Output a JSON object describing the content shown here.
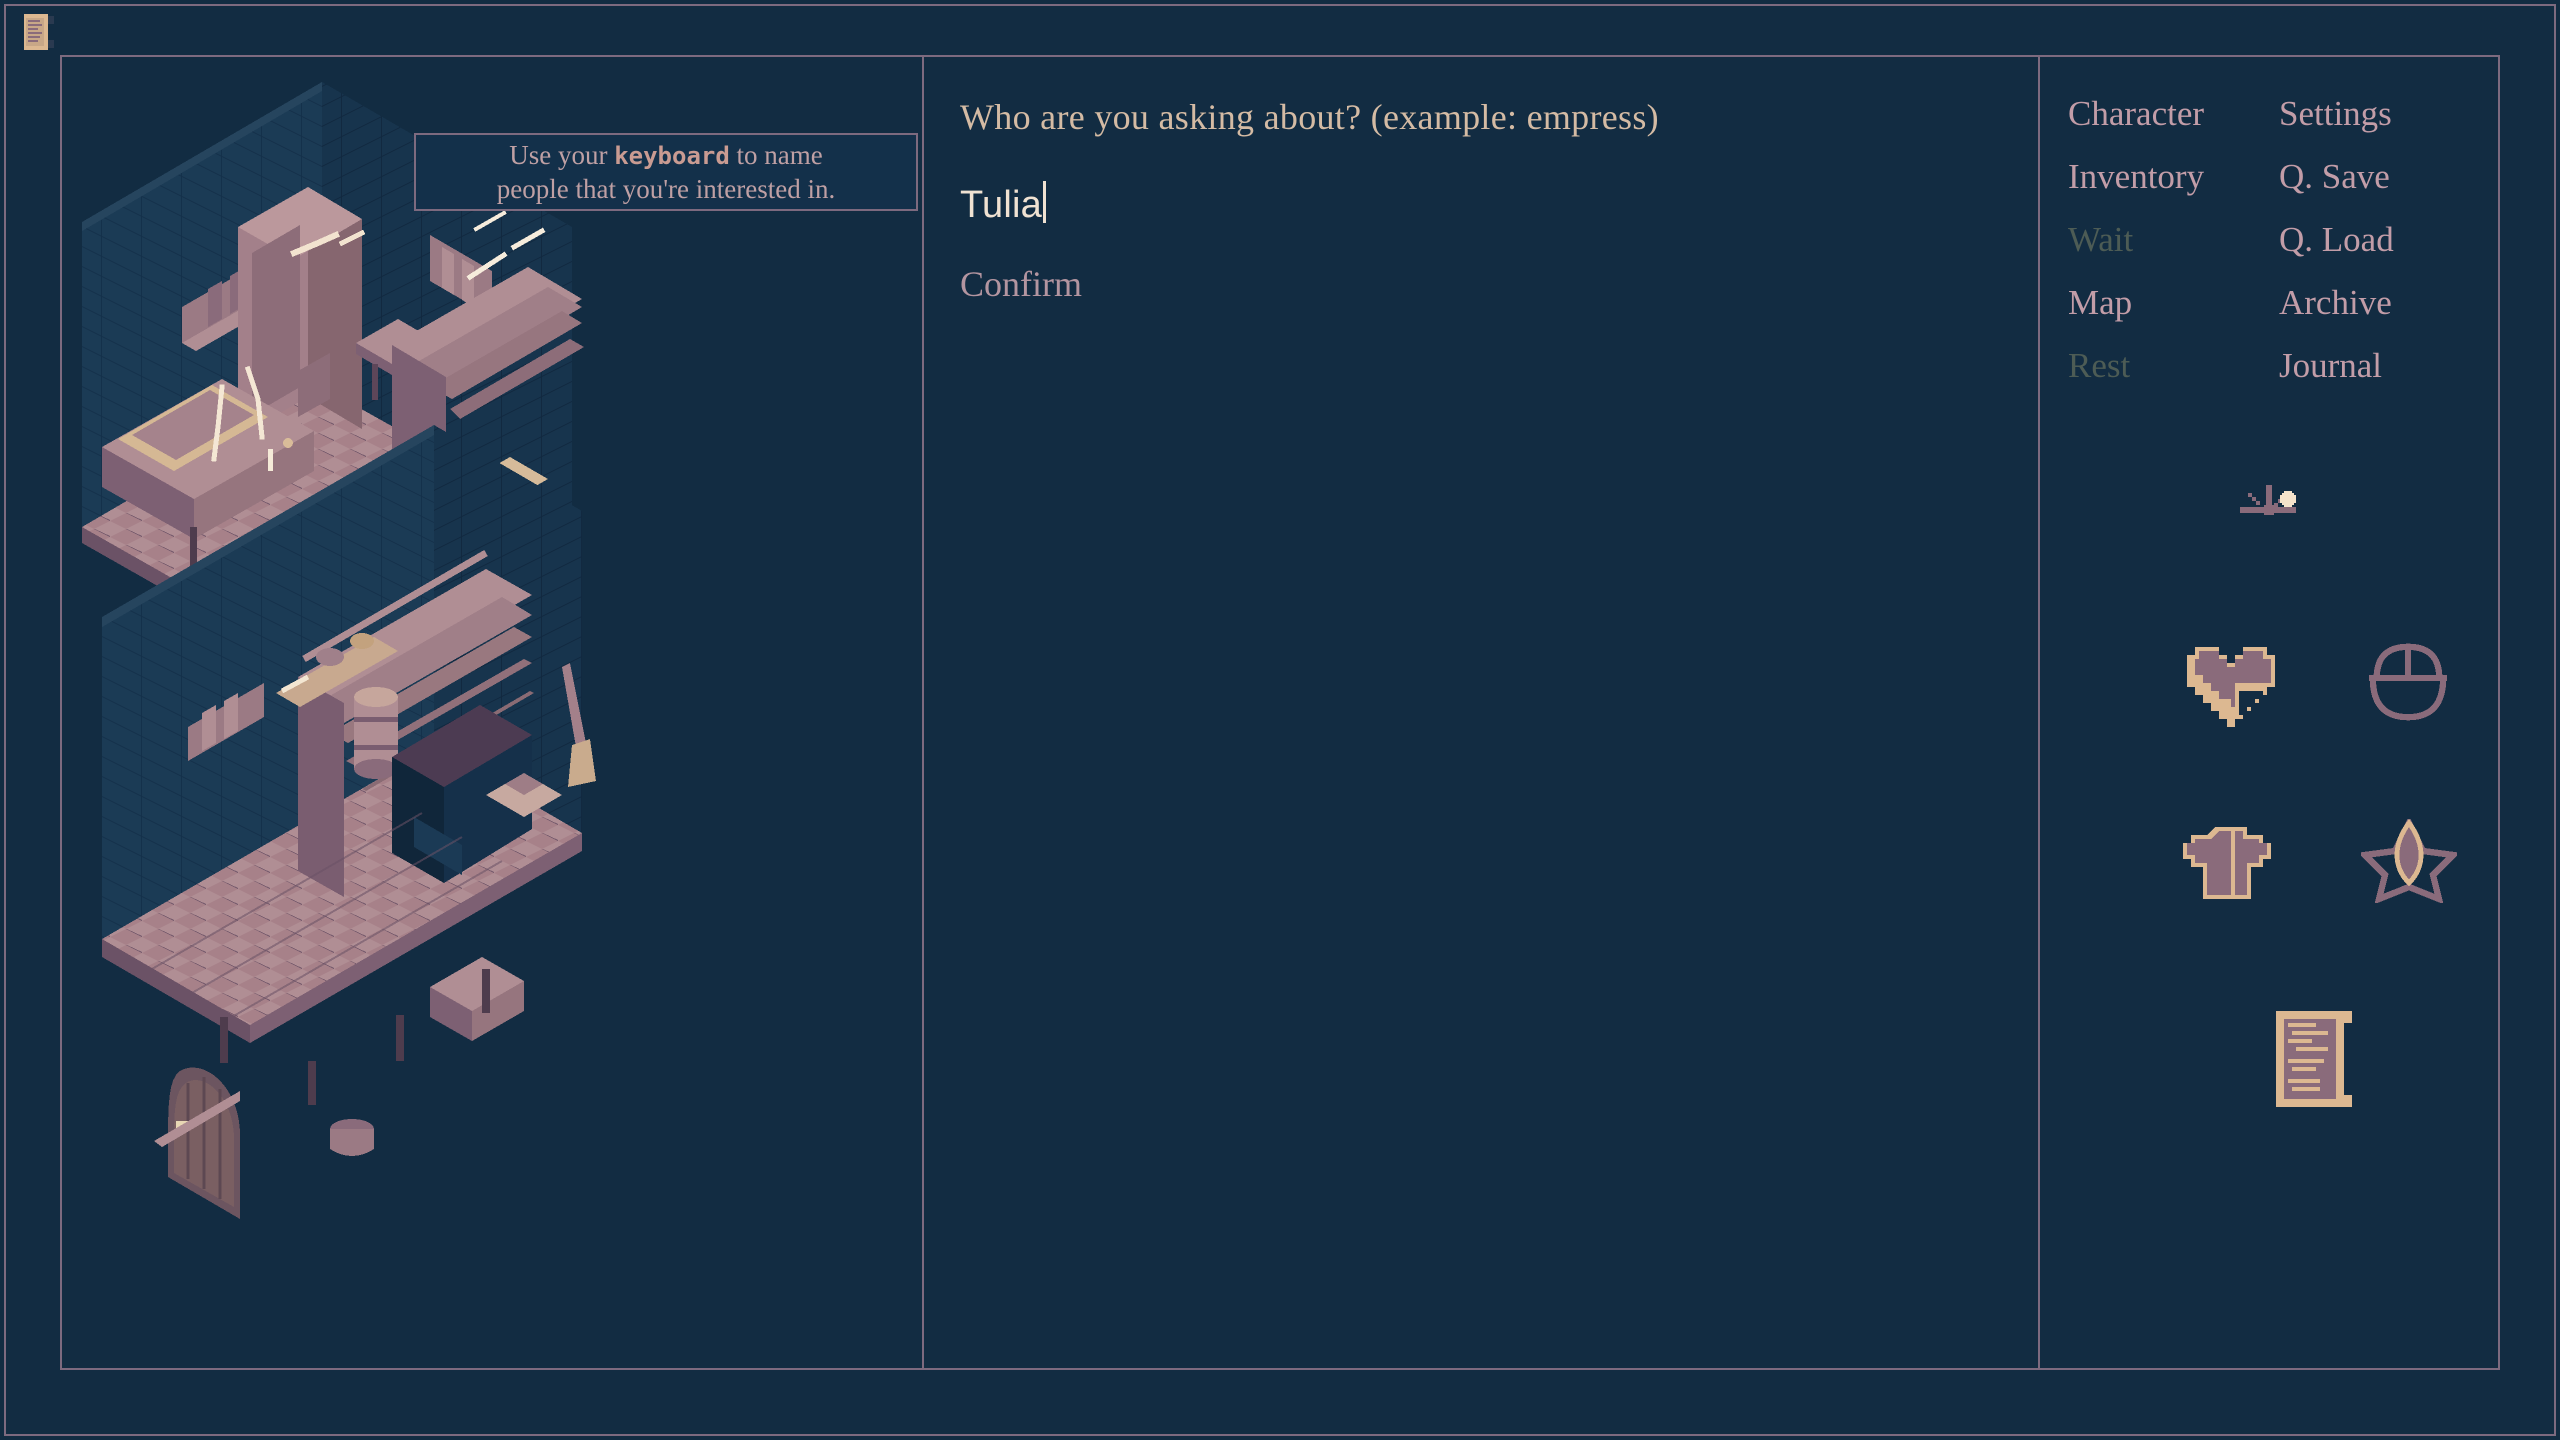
{
  "theme": {
    "background": "#122c42",
    "frame_border": "#7d6a7f",
    "prompt_text": "#d4bba4",
    "input_text": "#f0e2d2",
    "menu_text": "#c29da8",
    "menu_disabled": "#4d5c55",
    "tooltip_text": "#bfa0a4",
    "icon_outline": "#dcb891",
    "icon_fill": "#8a6b7b",
    "wall_dark": "#1a3a52",
    "wood_light": "#b08e94",
    "wood_mid": "#8a6b7b",
    "wood_dark": "#5a4558",
    "highlight": "#f2e3cf"
  },
  "cursor": {
    "icon": "scroll-icon"
  },
  "tooltip": {
    "line1_pre": "Use your ",
    "line1_kbd": "keyboard",
    "line1_post": " to name",
    "line2": "people that you're interested in."
  },
  "dialog": {
    "prompt": "Who are you asking about? (example: empress)",
    "input_value": "Tulia",
    "input_placeholder": "",
    "confirm_label": "Confirm"
  },
  "menu": {
    "items": [
      {
        "label": "Character",
        "column": "left",
        "enabled": true
      },
      {
        "label": "Settings",
        "column": "right",
        "enabled": true
      },
      {
        "label": "Inventory",
        "column": "left",
        "enabled": true
      },
      {
        "label": "Q. Save",
        "column": "right",
        "enabled": true
      },
      {
        "label": "Wait",
        "column": "left",
        "enabled": false
      },
      {
        "label": "Q. Load",
        "column": "right",
        "enabled": true
      },
      {
        "label": "Map",
        "column": "left",
        "enabled": true
      },
      {
        "label": "Archive",
        "column": "right",
        "enabled": true
      },
      {
        "label": "Rest",
        "column": "left",
        "enabled": false
      },
      {
        "label": "Journal",
        "column": "right",
        "enabled": true
      }
    ]
  },
  "status_icons": [
    {
      "name": "sundial-icon",
      "meaning": "time of day",
      "fill_pct": 0
    },
    {
      "name": "heart-icon",
      "meaning": "health",
      "fill_pct": 72
    },
    {
      "name": "bowl-icon",
      "meaning": "hunger",
      "fill_pct": 0
    },
    {
      "name": "shirt-icon",
      "meaning": "clothing",
      "fill_pct": 55
    },
    {
      "name": "star-icon",
      "meaning": "energy",
      "fill_pct": 18
    },
    {
      "name": "scroll-icon",
      "meaning": "journal",
      "fill_pct": 100
    }
  ],
  "world": {
    "view_name": "isometric-room-view",
    "rooms": [
      {
        "name": "upper-room",
        "contents": [
          "bed",
          "wall-shelves",
          "staircase",
          "table",
          "candle",
          "hanging-cloth"
        ]
      },
      {
        "name": "lower-room",
        "contents": [
          "arched-door",
          "staircase",
          "barrel",
          "broom",
          "fireplace",
          "shelf",
          "crates"
        ]
      }
    ]
  }
}
